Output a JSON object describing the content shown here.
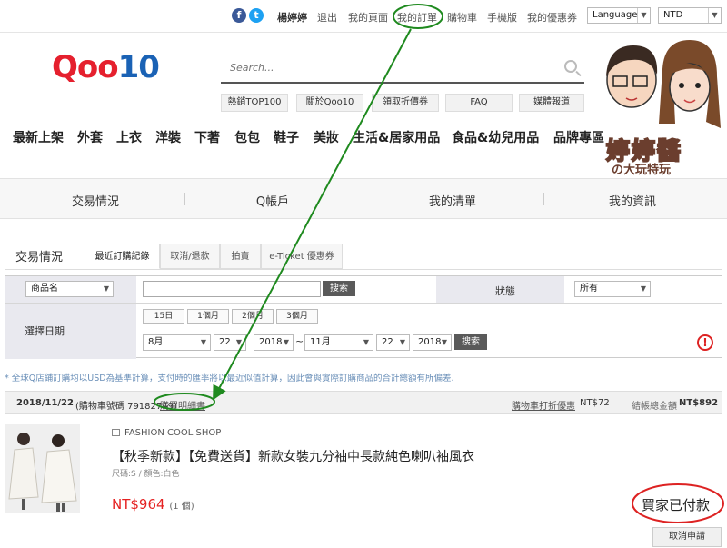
{
  "topbar": {
    "user": "楊婷婷",
    "links": [
      "退出",
      "我的頁面",
      "我的訂單",
      "購物車",
      "手機版",
      "我的優惠券"
    ],
    "language": "Language",
    "currency": "NTD"
  },
  "logo": {
    "part1": "Qoo",
    "part2": "10"
  },
  "search": {
    "placeholder": "Search..."
  },
  "quick_links": [
    "熱銷TOP100",
    "關於Qoo10",
    "領取折價券",
    "FAQ",
    "媒體報道"
  ],
  "categories": [
    "最新上架",
    "外套",
    "上衣",
    "洋裝",
    "下著",
    "包包",
    "鞋子",
    "美妝",
    "生活&居家用品",
    "食品&幼兒用品",
    "品牌專區"
  ],
  "blog_badge": {
    "line1": "婷婷醬",
    "line2": "の大玩特玩"
  },
  "main_tabs": [
    "交易情況",
    "Q帳戶",
    "我的清單",
    "我的資訊"
  ],
  "section_title": "交易情況",
  "sub_tabs": [
    "最近訂購記錄",
    "取消/退款",
    "拍賣",
    "e-Ticket 優惠券"
  ],
  "filter": {
    "field_select": "商品名",
    "search_button": "搜索",
    "status_label": "狀態",
    "status_value": "所有",
    "date_label": "選擇日期",
    "quick_ranges": [
      "15日",
      "1個月",
      "2個月",
      "3個月"
    ],
    "from_month": "8月",
    "from_day": "22",
    "from_year": "2018",
    "to_month": "11月",
    "to_day": "22",
    "to_year": "2018",
    "date_search_button": "搜索",
    "warn_icon": "!"
  },
  "note": "* 全球Q店鋪訂購均以USD為基準計算，支付時的匯率將以最近似值計算，因此會與實際訂購商品的合計總額有所偏差.",
  "order": {
    "date": "2018/11/22",
    "cart_no": "(購物車號碼 79182749)",
    "detail_link": "購買明細書",
    "discount_label": "購物車打折優惠",
    "discount_value": "NT$72",
    "total_label": "結帳總金額",
    "total_value": "NT$892"
  },
  "product": {
    "shop": "FASHION COOL SHOP",
    "title": "【秋季新款】【免費送貨】新款女裝九分袖中長款純色喇叭袖風衣",
    "options": "尺碼:S / 顏色:白色",
    "price": "NT$964",
    "qty": "(1 個)",
    "status": "買家已付款",
    "cancel": "取消申請"
  },
  "colors": {
    "accent_red": "#e5202e",
    "brand_blue": "#1a62b5",
    "annotation": "#1f8a1f",
    "price_red": "#e52222"
  }
}
